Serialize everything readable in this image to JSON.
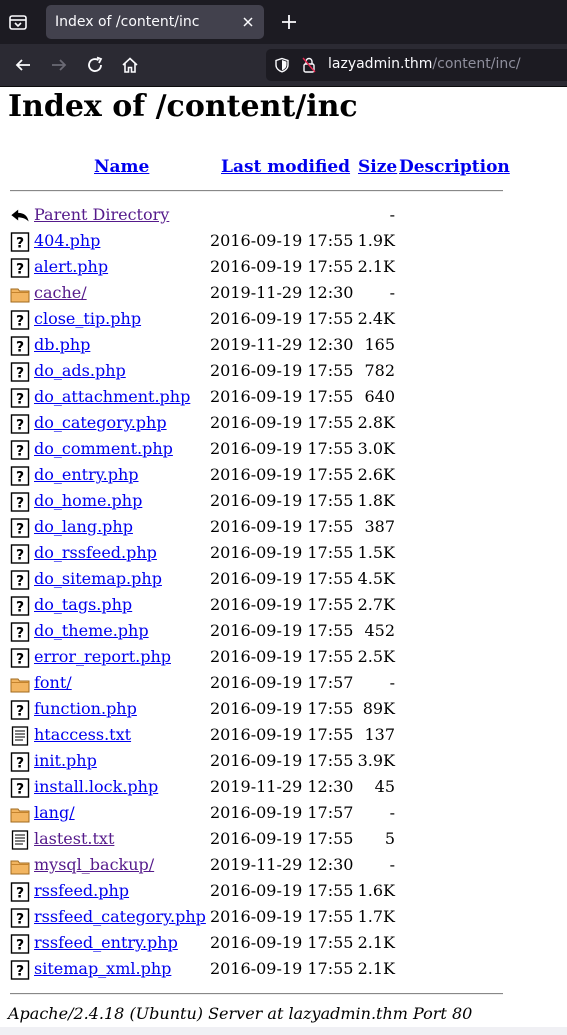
{
  "browser": {
    "tab_title": "Index of /content/inc",
    "url_host": "lazyadmin.thm",
    "url_path": "/content/inc/"
  },
  "page": {
    "heading": "Index of /content/inc",
    "columns": {
      "name": "Name",
      "modified": "Last modified",
      "size": "Size",
      "description": "Description"
    },
    "entries": [
      {
        "icon": "back-icon",
        "name": "Parent Directory",
        "date": "",
        "size": "-",
        "visited": true
      },
      {
        "icon": "unknown-file-icon",
        "name": "404.php",
        "date": "2016-09-19 17:55",
        "size": "1.9K",
        "visited": false
      },
      {
        "icon": "unknown-file-icon",
        "name": "alert.php",
        "date": "2016-09-19 17:55",
        "size": "2.1K",
        "visited": false
      },
      {
        "icon": "folder-icon",
        "name": "cache/",
        "date": "2019-11-29 12:30",
        "size": "-",
        "visited": true
      },
      {
        "icon": "unknown-file-icon",
        "name": "close_tip.php",
        "date": "2016-09-19 17:55",
        "size": "2.4K",
        "visited": false
      },
      {
        "icon": "unknown-file-icon",
        "name": "db.php",
        "date": "2019-11-29 12:30",
        "size": "165",
        "visited": false
      },
      {
        "icon": "unknown-file-icon",
        "name": "do_ads.php",
        "date": "2016-09-19 17:55",
        "size": "782",
        "visited": false
      },
      {
        "icon": "unknown-file-icon",
        "name": "do_attachment.php",
        "date": "2016-09-19 17:55",
        "size": "640",
        "visited": false
      },
      {
        "icon": "unknown-file-icon",
        "name": "do_category.php",
        "date": "2016-09-19 17:55",
        "size": "2.8K",
        "visited": false
      },
      {
        "icon": "unknown-file-icon",
        "name": "do_comment.php",
        "date": "2016-09-19 17:55",
        "size": "3.0K",
        "visited": false
      },
      {
        "icon": "unknown-file-icon",
        "name": "do_entry.php",
        "date": "2016-09-19 17:55",
        "size": "2.6K",
        "visited": false
      },
      {
        "icon": "unknown-file-icon",
        "name": "do_home.php",
        "date": "2016-09-19 17:55",
        "size": "1.8K",
        "visited": false
      },
      {
        "icon": "unknown-file-icon",
        "name": "do_lang.php",
        "date": "2016-09-19 17:55",
        "size": "387",
        "visited": false
      },
      {
        "icon": "unknown-file-icon",
        "name": "do_rssfeed.php",
        "date": "2016-09-19 17:55",
        "size": "1.5K",
        "visited": false
      },
      {
        "icon": "unknown-file-icon",
        "name": "do_sitemap.php",
        "date": "2016-09-19 17:55",
        "size": "4.5K",
        "visited": false
      },
      {
        "icon": "unknown-file-icon",
        "name": "do_tags.php",
        "date": "2016-09-19 17:55",
        "size": "2.7K",
        "visited": false
      },
      {
        "icon": "unknown-file-icon",
        "name": "do_theme.php",
        "date": "2016-09-19 17:55",
        "size": "452",
        "visited": false
      },
      {
        "icon": "unknown-file-icon",
        "name": "error_report.php",
        "date": "2016-09-19 17:55",
        "size": "2.5K",
        "visited": false
      },
      {
        "icon": "folder-icon",
        "name": "font/",
        "date": "2016-09-19 17:57",
        "size": "-",
        "visited": false
      },
      {
        "icon": "unknown-file-icon",
        "name": "function.php",
        "date": "2016-09-19 17:55",
        "size": "89K",
        "visited": false
      },
      {
        "icon": "text-file-icon",
        "name": "htaccess.txt",
        "date": "2016-09-19 17:55",
        "size": "137",
        "visited": false
      },
      {
        "icon": "unknown-file-icon",
        "name": "init.php",
        "date": "2016-09-19 17:55",
        "size": "3.9K",
        "visited": false
      },
      {
        "icon": "unknown-file-icon",
        "name": "install.lock.php",
        "date": "2019-11-29 12:30",
        "size": "45",
        "visited": false
      },
      {
        "icon": "folder-icon",
        "name": "lang/",
        "date": "2016-09-19 17:57",
        "size": "-",
        "visited": false
      },
      {
        "icon": "text-file-icon",
        "name": "lastest.txt",
        "date": "2016-09-19 17:55",
        "size": "5",
        "visited": true
      },
      {
        "icon": "folder-icon",
        "name": "mysql_backup/",
        "date": "2019-11-29 12:30",
        "size": "-",
        "visited": true
      },
      {
        "icon": "unknown-file-icon",
        "name": "rssfeed.php",
        "date": "2016-09-19 17:55",
        "size": "1.6K",
        "visited": false
      },
      {
        "icon": "unknown-file-icon",
        "name": "rssfeed_category.php",
        "date": "2016-09-19 17:55",
        "size": "1.7K",
        "visited": false
      },
      {
        "icon": "unknown-file-icon",
        "name": "rssfeed_entry.php",
        "date": "2016-09-19 17:55",
        "size": "2.1K",
        "visited": false
      },
      {
        "icon": "unknown-file-icon",
        "name": "sitemap_xml.php",
        "date": "2016-09-19 17:55",
        "size": "2.1K",
        "visited": false
      }
    ],
    "footer": "Apache/2.4.18 (Ubuntu) Server at lazyadmin.thm Port 80"
  },
  "colors": {
    "link": "#0000ee",
    "visited_link": "#551a8b",
    "chrome_dark": "#1c1b22",
    "chrome_toolbar": "#2b2a33",
    "folder": "#e8a34a"
  }
}
